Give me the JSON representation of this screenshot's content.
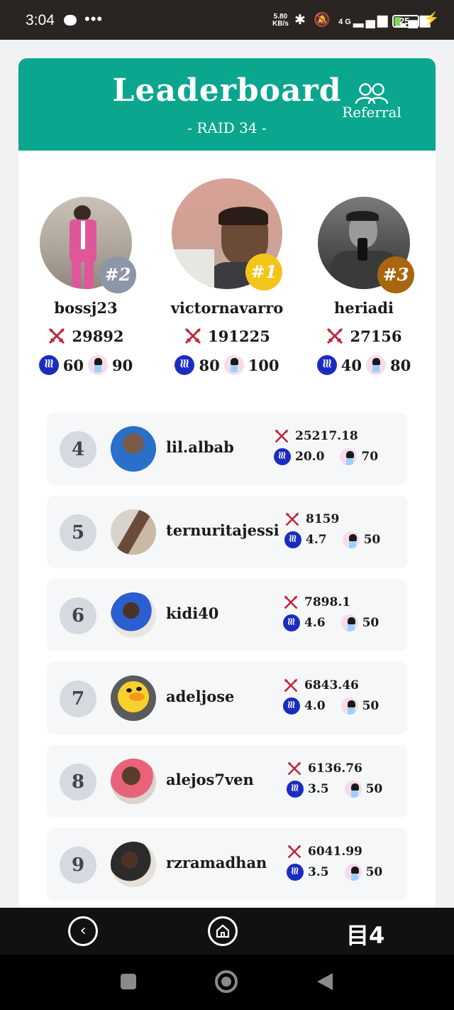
{
  "status_bar": {
    "time": "3:04",
    "speed_value": "5.80",
    "speed_unit": "KB/s",
    "network": "4G",
    "battery": "25"
  },
  "header": {
    "title": "Leaderboard",
    "subtitle": "- RAID 34 -",
    "referral_label": "Referral"
  },
  "podium": [
    {
      "rank": "#2",
      "name": "bossj23",
      "score": "29892",
      "steem": "60",
      "chibi": "90",
      "badge_color": "#8b96a6"
    },
    {
      "rank": "#1",
      "name": "victornavarro",
      "score": "191225",
      "steem": "80",
      "chibi": "100",
      "badge_color": "#f3c51b"
    },
    {
      "rank": "#3",
      "name": "heriadi",
      "score": "27156",
      "steem": "40",
      "chibi": "80",
      "badge_color": "#a8660e"
    }
  ],
  "rows": [
    {
      "rank": "4",
      "name": "lil.albab",
      "score": "25217.18",
      "steem": "20.0",
      "chibi": "70"
    },
    {
      "rank": "5",
      "name": "ternuritajessi",
      "score": "8159",
      "steem": "4.7",
      "chibi": "50"
    },
    {
      "rank": "6",
      "name": "kidi40",
      "score": "7898.1",
      "steem": "4.6",
      "chibi": "50"
    },
    {
      "rank": "7",
      "name": "adeljose",
      "score": "6843.46",
      "steem": "4.0",
      "chibi": "50"
    },
    {
      "rank": "8",
      "name": "alejos7ven",
      "score": "6136.76",
      "steem": "3.5",
      "chibi": "50"
    },
    {
      "rank": "9",
      "name": "rzramadhan",
      "score": "6041.99",
      "steem": "3.5",
      "chibi": "50"
    }
  ],
  "nav": {
    "back_icon": "chevron-left-icon",
    "home_icon": "home-icon",
    "right_label": "目4"
  },
  "colors": {
    "header_bg": "#0aa68e",
    "steem_blue": "#1a2cc0",
    "sword_red": "#c0243b"
  }
}
